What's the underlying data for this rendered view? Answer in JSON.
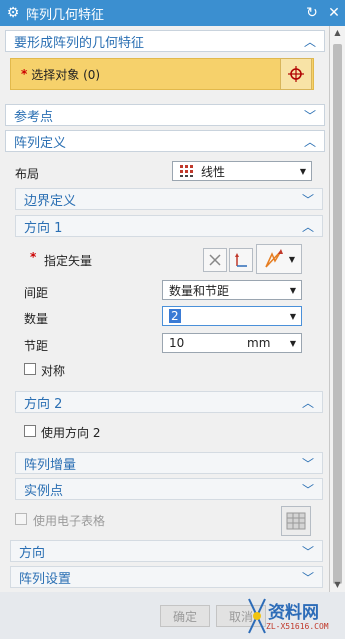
{
  "window": {
    "title": "阵列几何特征",
    "gear_icon": "gear-icon",
    "reset_icon": "reset-icon",
    "close_icon": "close-icon"
  },
  "sections": {
    "features": {
      "title": "要形成阵列的几何特征",
      "select_label": "选择对象 (0)",
      "select_required": "*"
    },
    "reference": {
      "title": "参考点"
    },
    "pattern_def": {
      "title": "阵列定义",
      "layout_label": "布局",
      "layout_value": "线性",
      "boundary_title": "边界定义",
      "direction1": {
        "title": "方向 1",
        "vector_required": "*",
        "vector_label": "指定矢量",
        "spacing_label": "间距",
        "spacing_value": "数量和节距",
        "count_label": "数量",
        "count_value": "2",
        "pitch_label": "节距",
        "pitch_value": "10",
        "pitch_unit": "mm",
        "symmetric_label": "对称"
      },
      "direction2": {
        "title": "方向 2",
        "use_direction2_label": "使用方向 2"
      },
      "increment_title": "阵列增量",
      "instance_title": "实例点",
      "use_spreadsheet_label": "使用电子表格"
    },
    "orientation": {
      "title": "方向"
    },
    "settings": {
      "title": "阵列设置"
    }
  },
  "buttons": {
    "ok": "确定",
    "cancel": "取消"
  },
  "watermark": {
    "brand": "资料网",
    "url": "ZL-X51616.COM"
  },
  "colors": {
    "titlebar": "#3b8fd0",
    "accent_text": "#2a6fb3",
    "selection_highlight": "#f6d16b",
    "required": "#cc0000"
  }
}
